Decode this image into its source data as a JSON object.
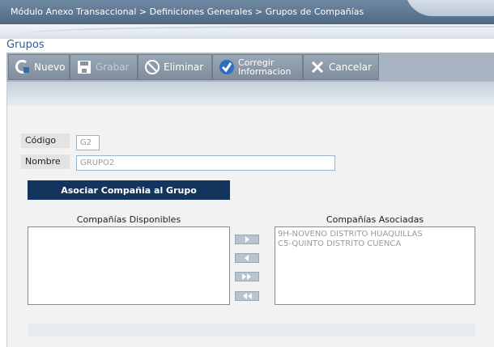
{
  "breadcrumb": "Módulo Anexo Transaccional > Definiciones Generales > Grupos de Compañías",
  "page_title": "Grupos",
  "toolbar": {
    "nuevo": "Nuevo",
    "grabar": "Grabar",
    "eliminar": "Eliminar",
    "corregir_line1": "Corregir",
    "corregir_line2": "Informacion",
    "cancelar": "Cancelar"
  },
  "form": {
    "codigo_label": "Código",
    "codigo_value": "G2",
    "nombre_label": "Nombre",
    "nombre_value": "GRUPO2"
  },
  "associate_button": "Asociar Compañia al Grupo",
  "available_title": "Compañías Disponibles",
  "available_items": [],
  "associated_title": "Compañías Asociadas",
  "associated_items": [
    "9H-NOVENO DISTRITO HUAQUILLAS",
    "C5-QUINTO DISTRITO CUENCA"
  ],
  "colors": {
    "title_blue": "#2a5d93",
    "button_navy": "#12345d"
  }
}
